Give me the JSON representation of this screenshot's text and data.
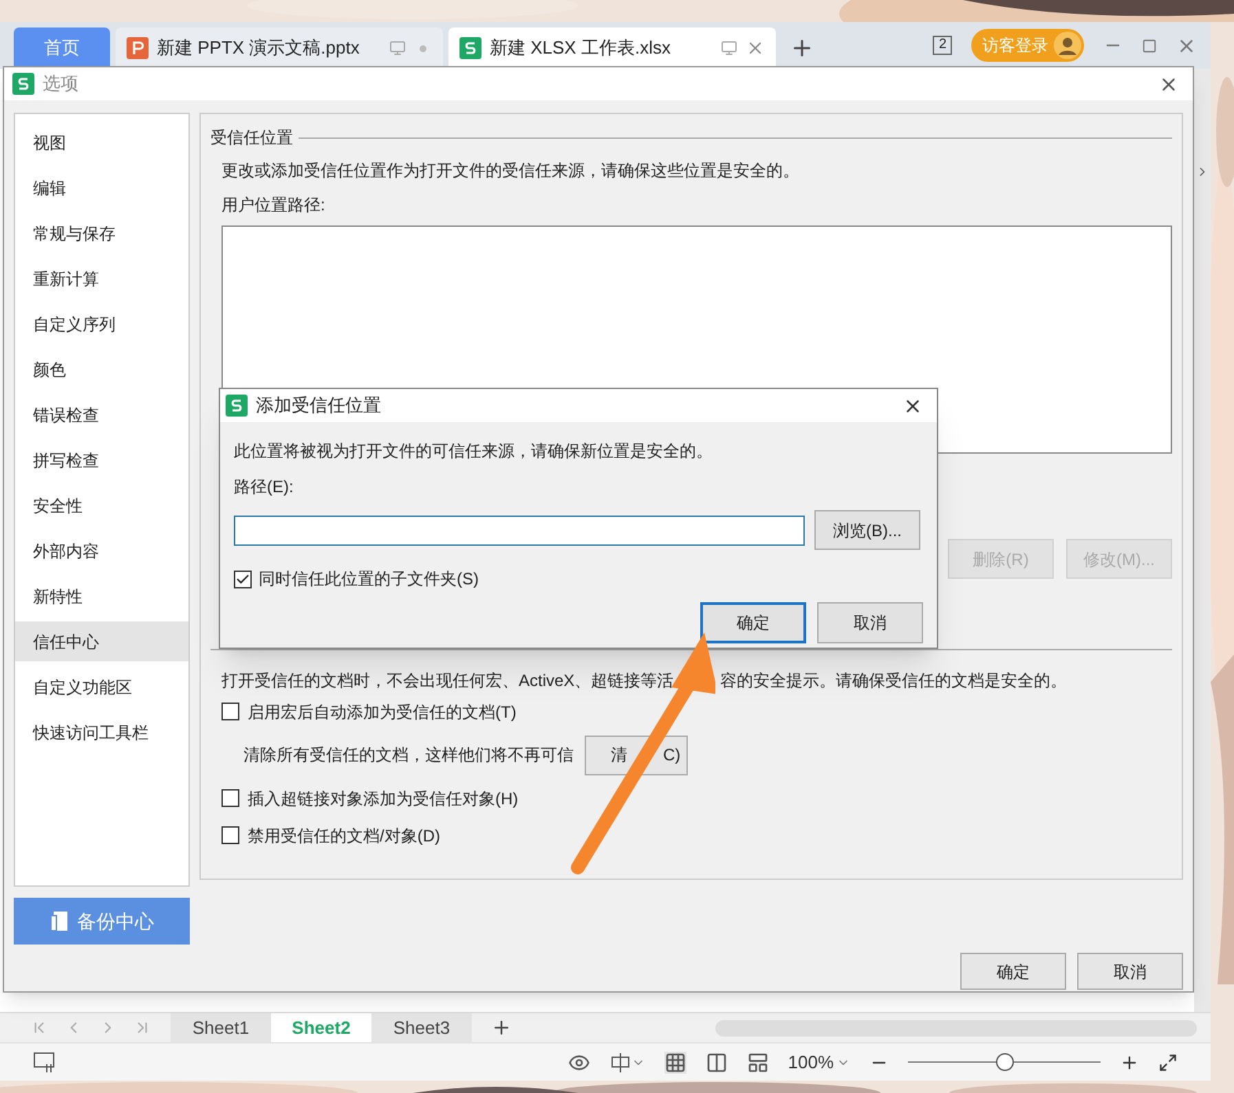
{
  "app_tabs": [
    {
      "label": "首页",
      "kind": "home",
      "selected": false
    },
    {
      "label": "新建 PPTX 演示文稿.pptx",
      "kind": "pptx",
      "selected": false
    },
    {
      "label": "新建 XLSX 工作表.xlsx",
      "kind": "xlsx",
      "selected": true
    }
  ],
  "tab_counter": "2",
  "login_button": "访客登录",
  "options_dialog": {
    "title": "选项",
    "sidebar": [
      {
        "label": "视图",
        "selected": false
      },
      {
        "label": "编辑",
        "selected": false
      },
      {
        "label": "常规与保存",
        "selected": false
      },
      {
        "label": "重新计算",
        "selected": false
      },
      {
        "label": "自定义序列",
        "selected": false
      },
      {
        "label": "颜色",
        "selected": false
      },
      {
        "label": "错误检查",
        "selected": false
      },
      {
        "label": "拼写检查",
        "selected": false
      },
      {
        "label": "安全性",
        "selected": false
      },
      {
        "label": "外部内容",
        "selected": false
      },
      {
        "label": "新特性",
        "selected": false
      },
      {
        "label": "信任中心",
        "selected": true
      },
      {
        "label": "自定义功能区",
        "selected": false
      },
      {
        "label": "快速访问工具栏",
        "selected": false
      }
    ],
    "backup_button": "备份中心",
    "trusted_locations": {
      "heading": "受信任位置",
      "description": "更改或添加受信任位置作为打开文件的受信任来源，请确保这些位置是安全的。",
      "path_label": "用户位置路径:",
      "buttons": [
        {
          "label": "删除(R)",
          "disabled": true
        },
        {
          "label": "修改(M)...",
          "disabled": true
        }
      ]
    },
    "trusted_documents": {
      "description_parts": [
        "打开受信任的文档时，不会出现任何宏、ActiveX、超链接等活",
        "容的安全提示。请确保受信任的文档是安全的。"
      ],
      "options": [
        {
          "kind": "checkbox",
          "label": "启用宏后自动添加为受信任的文档(T)",
          "checked": false
        },
        {
          "kind": "action",
          "label": "清除所有受信任的文档，这样他们将不再可信",
          "button_parts": [
            "清",
            "C)"
          ]
        },
        {
          "kind": "checkbox",
          "label": "插入超链接对象添加为受信任对象(H)",
          "checked": false
        },
        {
          "kind": "checkbox",
          "label": "禁用受信任的文档/对象(D)",
          "checked": false
        }
      ]
    },
    "buttons": [
      "确定",
      "取消"
    ]
  },
  "add_dialog": {
    "title": "添加受信任位置",
    "description": "此位置将被视为打开文件的可信任来源，请确保新位置是安全的。",
    "path_label": "路径(E):",
    "browse_button": "浏览(B)...",
    "subfolders": {
      "label": "同时信任此位置的子文件夹(S)",
      "checked": true
    },
    "buttons": [
      {
        "label": "确定",
        "selected": true
      },
      {
        "label": "取消",
        "selected": false
      }
    ]
  },
  "sheet_tabs": [
    {
      "label": "Sheet1",
      "selected": false
    },
    {
      "label": "Sheet2",
      "selected": true
    },
    {
      "label": "Sheet3",
      "selected": false
    }
  ],
  "zoom": {
    "label": "100%",
    "level": 0.5
  }
}
